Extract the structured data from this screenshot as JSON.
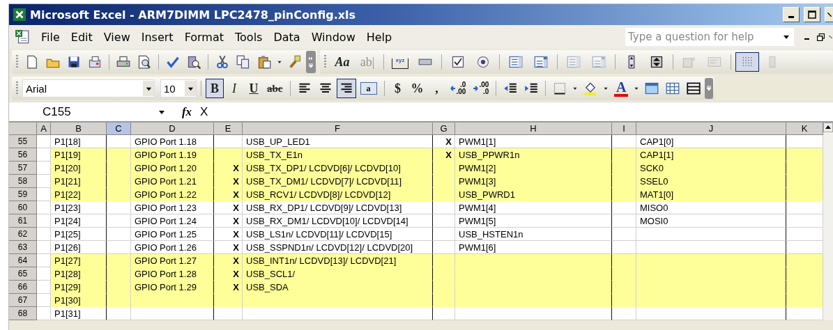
{
  "window": {
    "title": "Microsoft Excel - ARM7DIMM LPC2478_pinConfig.xls"
  },
  "menu": [
    "File",
    "Edit",
    "View",
    "Insert",
    "Format",
    "Tools",
    "Data",
    "Window",
    "Help"
  ],
  "help_box": {
    "placeholder": "Type a question for help"
  },
  "standard_toolbar": [
    {
      "buttons": [
        {
          "kind": "new",
          "pressed": false,
          "disabled": false
        },
        {
          "kind": "open",
          "pressed": false,
          "disabled": false
        },
        {
          "kind": "save",
          "pressed": false,
          "disabled": false
        },
        {
          "kind": "permission",
          "pressed": false,
          "disabled": false
        }
      ]
    },
    {
      "buttons": [
        {
          "kind": "print",
          "pressed": false,
          "disabled": false
        },
        {
          "kind": "preview",
          "pressed": false,
          "disabled": false
        }
      ]
    },
    {
      "buttons": [
        {
          "kind": "spelling",
          "pressed": false,
          "disabled": false
        },
        {
          "kind": "research",
          "pressed": false,
          "disabled": false
        }
      ]
    },
    {
      "buttons": [
        {
          "kind": "cut",
          "pressed": false,
          "disabled": false
        },
        {
          "kind": "copy",
          "pressed": false,
          "disabled": false
        },
        {
          "kind": "paste",
          "pressed": false,
          "disabled": false
        },
        {
          "kind": "caret",
          "pressed": false,
          "disabled": false
        },
        {
          "kind": "painter",
          "pressed": false,
          "disabled": false
        }
      ]
    }
  ],
  "forms_toolbar": [
    {
      "buttons": [
        {
          "kind": "text",
          "label": "Aa",
          "pressed": false,
          "disabled": false
        },
        {
          "kind": "text",
          "label": "ab|",
          "pressed": false,
          "disabled": true
        }
      ]
    },
    {
      "buttons": [
        {
          "kind": "groupbox",
          "label": "xyz",
          "pressed": false,
          "disabled": false
        },
        {
          "kind": "button",
          "pressed": false,
          "disabled": false
        }
      ]
    },
    {
      "buttons": [
        {
          "kind": "checkbox",
          "pressed": false,
          "disabled": false
        },
        {
          "kind": "radio",
          "pressed": false,
          "disabled": false
        }
      ]
    },
    {
      "buttons": [
        {
          "kind": "listbox",
          "pressed": false,
          "disabled": false
        },
        {
          "kind": "combobox",
          "pressed": false,
          "disabled": false
        }
      ]
    },
    {
      "buttons": [
        {
          "kind": "listbox",
          "pressed": false,
          "disabled": true
        },
        {
          "kind": "combobox",
          "pressed": false,
          "disabled": true
        }
      ]
    },
    {
      "buttons": [
        {
          "kind": "scrollbar",
          "pressed": false,
          "disabled": false
        },
        {
          "kind": "spinner",
          "pressed": false,
          "disabled": false
        }
      ]
    },
    {
      "buttons": [
        {
          "kind": "properties",
          "pressed": false,
          "disabled": true
        },
        {
          "kind": "code",
          "pressed": false,
          "disabled": true
        }
      ]
    },
    {
      "buttons": [
        {
          "kind": "grid",
          "pressed": true,
          "disabled": false
        },
        {
          "kind": "run",
          "pressed": false,
          "disabled": true
        }
      ]
    }
  ],
  "formatting_toolbar": {
    "font": "Arial",
    "size": "10",
    "groups": [
      {
        "buttons": [
          {
            "kind": "text",
            "label": "B",
            "pressed": true
          },
          {
            "kind": "text",
            "label": "I",
            "pressed": false
          },
          {
            "kind": "text",
            "label": "U",
            "pressed": false
          },
          {
            "kind": "text",
            "label": "abc",
            "pressed": false
          }
        ]
      },
      {
        "buttons": [
          {
            "kind": "align-left",
            "pressed": false
          },
          {
            "kind": "align-center",
            "pressed": false
          },
          {
            "kind": "align-right",
            "pressed": true
          },
          {
            "kind": "merge",
            "label": "a",
            "pressed": false
          }
        ]
      },
      {
        "buttons": [
          {
            "kind": "text",
            "label": "$",
            "pressed": false
          },
          {
            "kind": "text",
            "label": "%",
            "pressed": false
          },
          {
            "kind": "text",
            "label": ",",
            "pressed": false
          },
          {
            "kind": "increase-decimal",
            "lines": [
              ".0",
              ".00"
            ],
            "pressed": false
          },
          {
            "kind": "decrease-decimal",
            "lines": [
              ".00",
              ".0"
            ],
            "pressed": false
          }
        ]
      },
      {
        "buttons": [
          {
            "kind": "outdent",
            "pressed": false
          },
          {
            "kind": "indent",
            "pressed": false
          }
        ]
      },
      {
        "buttons": [
          {
            "kind": "borders",
            "pressed": false
          },
          {
            "kind": "caret",
            "pressed": false
          },
          {
            "kind": "fill",
            "pressed": false
          },
          {
            "kind": "caret",
            "pressed": false
          },
          {
            "kind": "font-color",
            "label": "A",
            "pressed": false
          },
          {
            "kind": "caret",
            "pressed": false
          },
          {
            "kind": "window",
            "pressed": false
          },
          {
            "kind": "table",
            "pressed": false
          },
          {
            "kind": "rows",
            "pressed": false
          }
        ]
      }
    ]
  },
  "formula_bar": {
    "name_box": "C155",
    "function_label": "fx",
    "formula": "X"
  },
  "sheet": {
    "columns": [
      {
        "label": "A",
        "selected": false
      },
      {
        "label": "B",
        "selected": false
      },
      {
        "label": "C",
        "selected": true
      },
      {
        "label": "D",
        "selected": false
      },
      {
        "label": "E",
        "selected": false
      },
      {
        "label": "F",
        "selected": false
      },
      {
        "label": "G",
        "selected": false
      },
      {
        "label": "H",
        "selected": false
      },
      {
        "label": "I",
        "selected": false
      },
      {
        "label": "J",
        "selected": false
      },
      {
        "label": "K",
        "selected": false
      }
    ],
    "rows": [
      {
        "number": "55",
        "highlighted": false,
        "cells": [
          null,
          "P1[18]",
          null,
          "GPIO Port 1.18",
          null,
          "USB_UP_LED1",
          "X",
          "PWM1[1]",
          null,
          "CAP1[0]",
          null
        ]
      },
      {
        "number": "56",
        "highlighted": true,
        "cells": [
          null,
          "P1[19]",
          null,
          "GPIO Port 1.19",
          null,
          "USB_TX_E1n",
          "X",
          "USB_PPWR1n",
          null,
          "CAP1[1]",
          null
        ]
      },
      {
        "number": "57",
        "highlighted": true,
        "cells": [
          null,
          "P1[20]",
          null,
          "GPIO Port 1.20",
          "X",
          "USB_TX_DP1/ LCDVD[6]/ LCDVD[10]",
          null,
          "PWM1[2]",
          null,
          "SCK0",
          null
        ]
      },
      {
        "number": "58",
        "highlighted": true,
        "cells": [
          null,
          "P1[21]",
          null,
          "GPIO Port 1.21",
          "X",
          "USB_TX_DM1/ LCDVD[7]/ LCDVD[11]",
          null,
          "PWM1[3]",
          null,
          "SSEL0",
          null
        ]
      },
      {
        "number": "59",
        "highlighted": true,
        "cells": [
          null,
          "P1[22]",
          null,
          "GPIO Port 1.22",
          "X",
          "USB_RCV1/ LCDVD[8]/ LCDVD[12]",
          null,
          "USB_PWRD1",
          null,
          "MAT1[0]",
          null
        ]
      },
      {
        "number": "60",
        "highlighted": false,
        "cells": [
          null,
          "P1[23]",
          null,
          "GPIO Port 1.23",
          "X",
          "USB_RX_DP1/ LCDVD[9]/ LCDVD[13]",
          null,
          "PWM1[4]",
          null,
          "MISO0",
          null
        ]
      },
      {
        "number": "61",
        "highlighted": false,
        "cells": [
          null,
          "P1[24]",
          null,
          "GPIO Port 1.24",
          "X",
          "USB_RX_DM1/ LCDVD[10]/ LCDVD[14]",
          null,
          "PWM1[5]",
          null,
          "MOSI0",
          null
        ]
      },
      {
        "number": "62",
        "highlighted": false,
        "cells": [
          null,
          "P1[25]",
          null,
          "GPIO Port 1.25",
          "X",
          "USB_LS1n/ LCDVD[11]/ LCDVD[15]",
          null,
          "USB_HSTEN1n",
          null,
          null,
          null
        ]
      },
      {
        "number": "63",
        "highlighted": false,
        "cells": [
          null,
          "P1[26]",
          null,
          "GPIO Port 1.26",
          "X",
          "USB_SSPND1n/ LCDVD[12]/ LCDVD[20]",
          null,
          "PWM1[6]",
          null,
          null,
          null
        ]
      },
      {
        "number": "64",
        "highlighted": true,
        "cells": [
          null,
          "P1[27]",
          null,
          "GPIO Port 1.27",
          "X",
          "USB_INT1n/ LCDVD[13]/ LCDVD[21]",
          null,
          null,
          null,
          null,
          null
        ]
      },
      {
        "number": "65",
        "highlighted": true,
        "cells": [
          null,
          "P1[28]",
          null,
          "GPIO Port 1.28",
          "X",
          "USB_SCL1/",
          null,
          null,
          null,
          null,
          null
        ]
      },
      {
        "number": "66",
        "highlighted": true,
        "cells": [
          null,
          "P1[29]",
          null,
          "GPIO Port 1.29",
          "X",
          "USB_SDA",
          null,
          null,
          null,
          null,
          null
        ]
      },
      {
        "number": "67",
        "highlighted": true,
        "cells": [
          null,
          "P1[30]",
          null,
          null,
          null,
          null,
          null,
          null,
          null,
          null,
          null
        ]
      },
      {
        "number": "68",
        "highlighted": false,
        "cells": [
          null,
          "P1[31]",
          null,
          null,
          null,
          null,
          null,
          null,
          null,
          null,
          null
        ]
      }
    ]
  }
}
